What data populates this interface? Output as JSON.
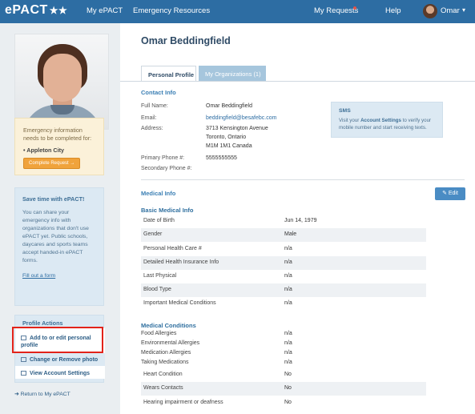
{
  "nav": {
    "logo": "ePACT",
    "logo_stars": "★★",
    "my_epact": "My ePACT",
    "emergency_resources": "Emergency Resources",
    "my_requests": "My Requests",
    "help": "Help",
    "user": "Omar",
    "notification_color": "#e0544a"
  },
  "sidebar": {
    "emergency": {
      "text": "Emergency information needs to be completed for:",
      "item": "Appleton City",
      "button": "Complete Request →"
    },
    "promo": {
      "heading": "Save time with ePACT!",
      "body": "You can share your emergency info with organizations that don't use ePACT yet. Public schools, daycares and sports teams accept handed-in ePACT forms.",
      "link": "Fill out a form"
    },
    "profile_actions": {
      "heading": "Profile Actions",
      "items": [
        {
          "label": "Add to or edit personal profile",
          "icon": "edit-icon"
        },
        {
          "label": "Change or Remove photo",
          "icon": "photo-icon"
        },
        {
          "label": "View Account Settings",
          "icon": "settings-icon"
        }
      ]
    },
    "back_link": "Return to My ePACT"
  },
  "main": {
    "name": "Omar Beddingfield",
    "tabs": [
      {
        "label": "Personal Profile"
      },
      {
        "label": "My Organizations (1)"
      }
    ],
    "contact": {
      "heading": "Contact Info",
      "full_name_label": "Full Name:",
      "full_name": "Omar Beddingfield",
      "email_label": "Email:",
      "email": "beddingfield@besafebc.com",
      "address_label": "Address:",
      "address_line1": "3713 Kensington Avenue",
      "address_line2": "Toronto, Ontario",
      "address_line3": "M1M 1M1 Canada",
      "primary_phone_label": "Primary Phone #:",
      "primary_phone": "5555555555",
      "secondary_phone_label": "Secondary Phone #:"
    },
    "sms": {
      "heading": "SMS",
      "text_before": "Visit your ",
      "text_bold": "Account Settings",
      "text_after": " to verify your mobile number and start receiving texts."
    },
    "medical": {
      "heading": "Medical Info",
      "edit_button": "Edit",
      "basic_heading": "Basic Medical Info",
      "basic_rows": [
        {
          "label": "Date of Birth",
          "value": "Jun 14, 1979"
        },
        {
          "label": "Gender",
          "value": "Male"
        },
        {
          "label": "Personal Health Care #",
          "value": "n/a"
        },
        {
          "label": "Detailed Health Insurance Info",
          "value": "n/a"
        },
        {
          "label": "Last Physical",
          "value": "n/a"
        },
        {
          "label": "Blood Type",
          "value": "n/a"
        },
        {
          "label": "Important Medical Conditions",
          "value": "n/a"
        }
      ],
      "conditions_heading": "Medical Conditions",
      "condition_plain_rows": [
        {
          "label": "Food Allergies",
          "value": "n/a"
        },
        {
          "label": "Environmental Allergies",
          "value": "n/a"
        },
        {
          "label": "Medication Allergies",
          "value": "n/a"
        },
        {
          "label": "Taking Medications",
          "value": "n/a"
        }
      ],
      "condition_table_rows": [
        {
          "label": "Heart Condition",
          "value": "No"
        },
        {
          "label": "Wears Contacts",
          "value": "No"
        },
        {
          "label": "Hearing impairment or deafness",
          "value": "No"
        }
      ]
    }
  }
}
